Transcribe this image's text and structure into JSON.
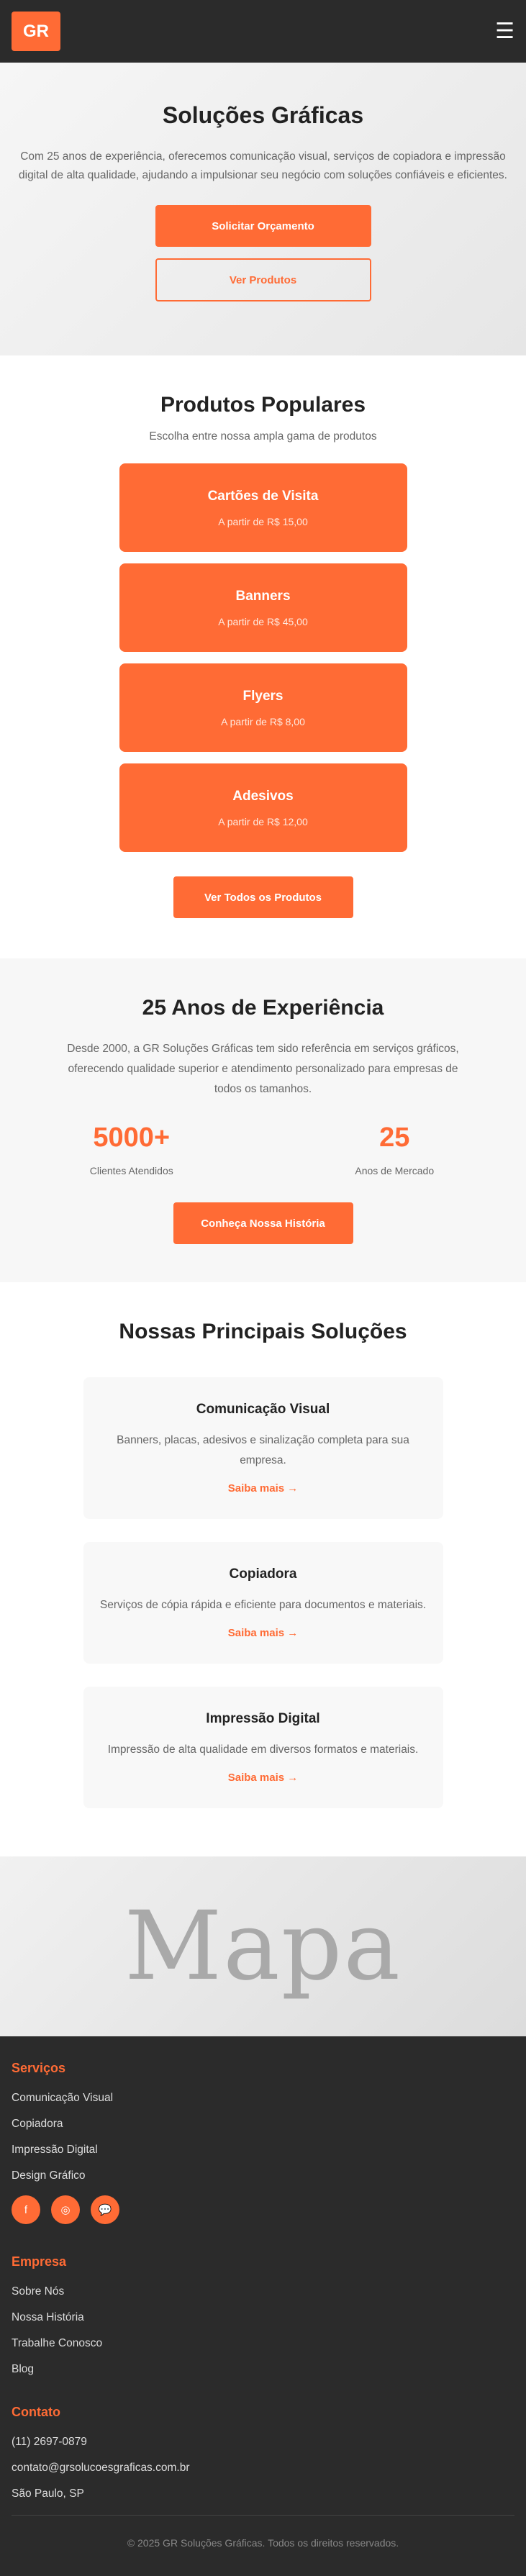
{
  "header": {
    "logo": "GR",
    "menu_icon": "☰"
  },
  "hero": {
    "title": "Soluções Gráficas",
    "description": "Com 25 anos de experiência, oferecemos comunicação visual, serviços de copiadora e impressão digital de alta qualidade, ajudando a impulsionar seu negócio com soluções confiáveis e eficientes.",
    "primary_button": "Solicitar Orçamento",
    "secondary_button": "Ver Produtos"
  },
  "products": {
    "title": "Produtos Populares",
    "subtitle": "Escolha entre nossa ampla gama de produtos",
    "items": [
      {
        "name": "Cartões de Visita",
        "price": "A partir de R$ 15,00"
      },
      {
        "name": "Banners",
        "price": "A partir de R$ 45,00"
      },
      {
        "name": "Flyers",
        "price": "A partir de R$ 8,00"
      },
      {
        "name": "Adesivos",
        "price": "A partir de R$ 12,00"
      }
    ],
    "button": "Ver Todos os Produtos"
  },
  "experience": {
    "title": "25 Anos de Experiência",
    "description": "Desde 2000, a GR Soluções Gráficas tem sido referência em serviços gráficos, oferecendo qualidade superior e atendimento personalizado para empresas de todos os tamanhos.",
    "stats": [
      {
        "number": "5000+",
        "label": "Clientes Atendidos"
      },
      {
        "number": "25",
        "label": "Anos de Mercado"
      }
    ],
    "button": "Conheça Nossa História"
  },
  "solutions": {
    "title": "Nossas Principais Soluções",
    "items": [
      {
        "title": "Comunicação Visual",
        "description": "Banners, placas, adesivos e sinalização completa para sua empresa.",
        "link": "Saiba mais →"
      },
      {
        "title": "Copiadora",
        "description": "Serviços de cópia rápida e eficiente para documentos e materiais.",
        "link": "Saiba mais →"
      },
      {
        "title": "Impressão Digital",
        "description": "Impressão de alta qualidade em diversos formatos e materiais.",
        "link": "Saiba mais →"
      }
    ]
  },
  "map": {
    "label": "Mapa"
  },
  "footer": {
    "services": {
      "title": "Serviços",
      "links": [
        "Comunicação Visual",
        "Copiadora",
        "Impressão Digital",
        "Design Gráfico"
      ]
    },
    "socials": [
      {
        "icon": "facebook-icon",
        "glyph": "f"
      },
      {
        "icon": "instagram-icon",
        "glyph": "◎"
      },
      {
        "icon": "whatsapp-icon",
        "glyph": "💬"
      }
    ],
    "company": {
      "title": "Empresa",
      "links": [
        "Sobre Nós",
        "Nossa História",
        "Trabalhe Conosco",
        "Blog"
      ]
    },
    "contact": {
      "title": "Contato",
      "phone": "(11) 2697-0879",
      "email": "contato@grsolucoesgraficas.com.br",
      "location": "São Paulo, SP"
    },
    "copyright": "© 2025 GR Soluções Gráficas. Todos os direitos reservados."
  },
  "colors": {
    "accent": "#ff6b35",
    "dark": "#2b2b2b"
  }
}
